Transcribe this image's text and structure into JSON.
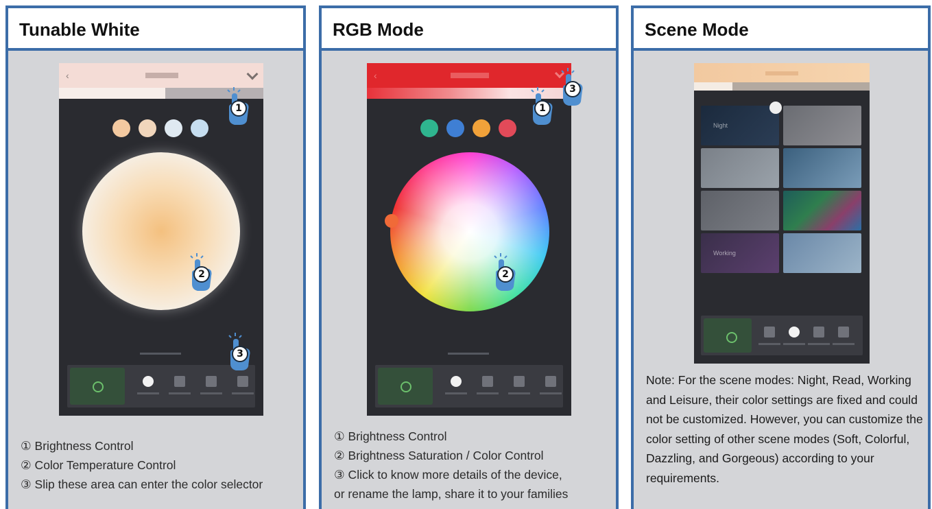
{
  "panels": [
    {
      "title": "Tunable White",
      "captions": [
        "① Brightness Control",
        "② Color Temperature Control",
        "③ Slip these area can enter the color selector"
      ],
      "markers": [
        "1",
        "2",
        "3"
      ],
      "swatch_colors": [
        "#f3c9a0",
        "#f1d6bc",
        "#dfe9f1",
        "#c6def0"
      ]
    },
    {
      "title": "RGB Mode",
      "captions": [
        "① Brightness Control",
        "② Brightness Saturation / Color Control",
        "③ Click to know more details of the device,",
        "or rename the lamp, share it to your families"
      ],
      "markers": [
        "1",
        "2",
        "3"
      ],
      "swatch_colors": [
        "#2fb58f",
        "#3f7fd4",
        "#f1a23a",
        "#e24a59"
      ]
    },
    {
      "title": "Scene Mode",
      "note": "Note: For the scene modes: Night, Read, Working and Leisure, their color settings are fixed and could not be customized. However, you can customize the color setting of other scene modes (Soft, Colorful, Dazzling, and Gorgeous) according to your requirements.",
      "scene_labels": [
        "Night",
        "",
        "",
        "",
        "",
        "",
        "Working",
        ""
      ]
    }
  ],
  "colors": {
    "border": "#3c6da8",
    "panel_bg": "#d4d5d8",
    "phone_bg": "#2a2b30",
    "rgb_header": "#e0272c",
    "hand": "#4f8fd0"
  }
}
